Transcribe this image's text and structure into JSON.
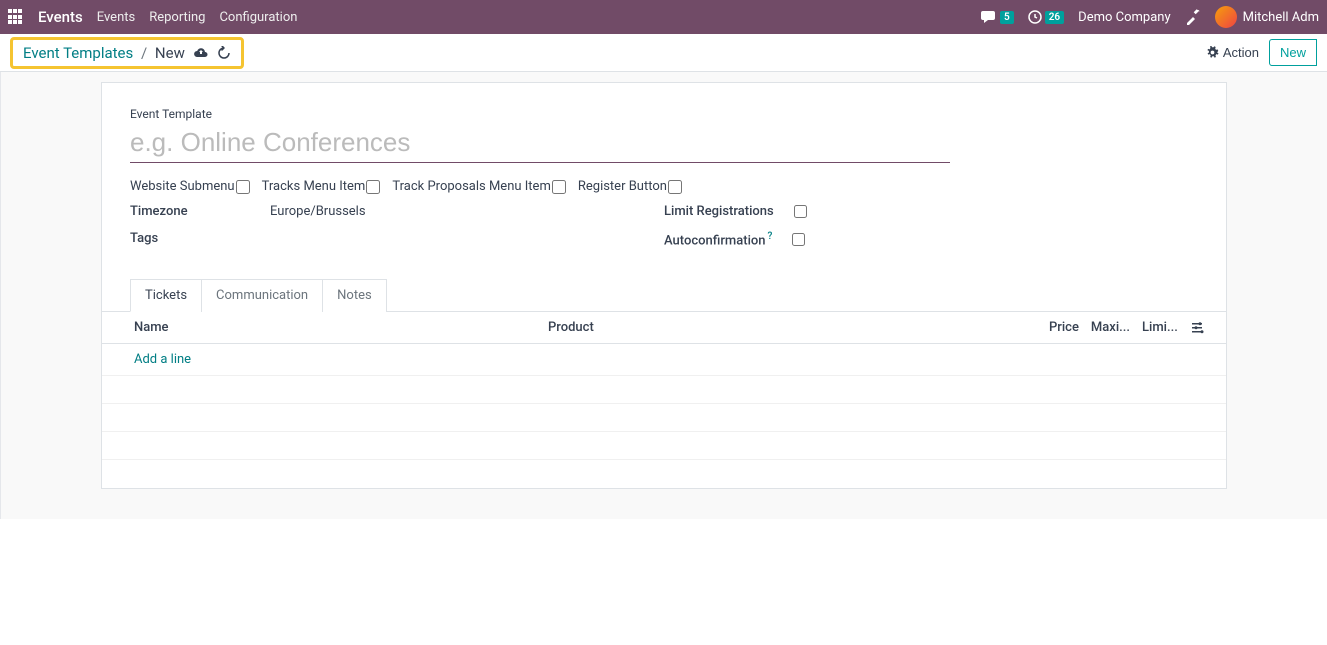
{
  "nav": {
    "app_name": "Events",
    "items": [
      "Events",
      "Reporting",
      "Configuration"
    ],
    "chat_count": "5",
    "clock_count": "26",
    "company": "Demo Company",
    "user": "Mitchell Adm"
  },
  "breadcrumb": {
    "root": "Event Templates",
    "current": "New"
  },
  "controls": {
    "action": "Action",
    "new": "New"
  },
  "form": {
    "label_event_template": "Event Template",
    "title_placeholder": "e.g. Online Conferences",
    "checks": {
      "website_submenu": "Website Submenu",
      "tracks_menu_item": "Tracks Menu Item",
      "track_proposals_menu_item": "Track Proposals Menu Item",
      "register_button": "Register Button"
    },
    "timezone_label": "Timezone",
    "timezone_value": "Europe/Brussels",
    "tags_label": "Tags",
    "limit_registrations_label": "Limit Registrations",
    "autoconfirmation_label": "Autoconfirmation"
  },
  "tabs": [
    "Tickets",
    "Communication",
    "Notes"
  ],
  "table": {
    "headers": {
      "name": "Name",
      "product": "Product",
      "price": "Price",
      "maximum": "Maxi...",
      "limit": "Limi..."
    },
    "add_line": "Add a line"
  }
}
